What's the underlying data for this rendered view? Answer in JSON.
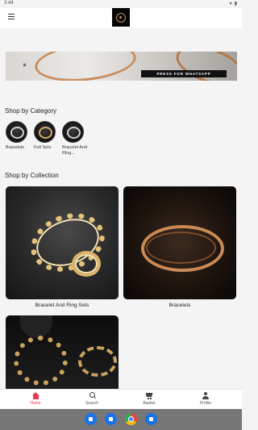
{
  "status_bar": {
    "time": "3:44"
  },
  "banner": {
    "button_label": "PRESS FOR WHATSAPP"
  },
  "categories_section": {
    "title": "Shop by Category",
    "items": [
      {
        "label": "Bracelets"
      },
      {
        "label": "Full Sets"
      },
      {
        "label": "Bracelet And Ring..."
      }
    ]
  },
  "collections_section": {
    "title": "Shop by Collection",
    "items": [
      {
        "label": "Bracelet And Ring Sets"
      },
      {
        "label": "Bracelets"
      },
      {
        "label": ""
      }
    ]
  },
  "bottom_nav": {
    "items": [
      {
        "label": "Home",
        "active": true
      },
      {
        "label": "Search"
      },
      {
        "label": "Basket"
      },
      {
        "label": "Profile"
      }
    ]
  },
  "dock": {
    "apps": [
      "phone-icon",
      "messages-icon",
      "chrome-icon",
      "camera-icon"
    ]
  },
  "colors": {
    "accent": "#e8384f",
    "logo_gold": "#b8955a",
    "whatsapp_button": "#111111"
  }
}
